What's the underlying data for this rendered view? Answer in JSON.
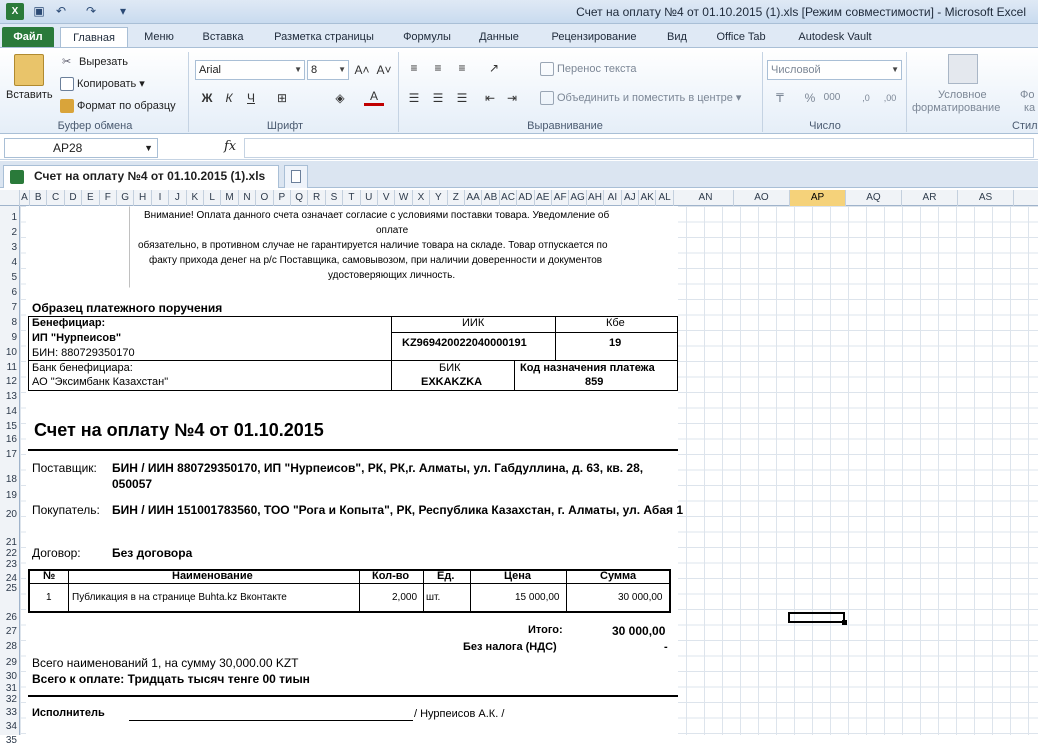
{
  "window": {
    "title": "Счет на оплату №4 от 01.10.2015 (1).xls  [Режим совместимости]  -  Microsoft Excel"
  },
  "tabs": [
    "Файл",
    "Главная",
    "Меню",
    "Вставка",
    "Разметка страницы",
    "Формулы",
    "Данные",
    "Рецензирование",
    "Вид",
    "Office Tab",
    "Autodesk Vault"
  ],
  "ribbon": {
    "paste": "Вставить",
    "cut": "Вырезать",
    "copy": "Копировать",
    "format_painter": "Формат по образцу",
    "clipboard_group": "Буфер обмена",
    "font_name": "Arial",
    "font_size": "8",
    "font_group": "Шрифт",
    "wrap_text": "Перенос текста",
    "merge_center": "Объединить и поместить в центре",
    "alignment_group": "Выравнивание",
    "number_format": "Числовой",
    "number_group": "Число",
    "conditional_1": "Условное",
    "conditional_2": "форматирование",
    "format_as_1": "Фо",
    "format_as_2": "ка",
    "styles_group": "Стил"
  },
  "formula_bar": {
    "name_box": "AP28",
    "fx": "fx",
    "value": ""
  },
  "doc_tab": "Счет на оплату №4 от 01.10.2015 (1).xls",
  "columns_narrow": [
    "A",
    "B",
    "C",
    "D",
    "E",
    "F",
    "G",
    "H",
    "I",
    "J",
    "K",
    "L",
    "M",
    "N",
    "O",
    "P",
    "Q",
    "R",
    "S",
    "T",
    "U",
    "V",
    "W",
    "X",
    "Y",
    "Z",
    "AA",
    "AB",
    "AC",
    "AD",
    "AE",
    "AF",
    "AG",
    "AH",
    "AI",
    "AJ",
    "AK",
    "AL"
  ],
  "columns_wide": [
    "AN",
    "AO",
    "AP",
    "AQ",
    "AR",
    "AS"
  ],
  "selected_column": "AP",
  "rows": [
    "1",
    "2",
    "3",
    "4",
    "5",
    "6",
    "7",
    "8",
    "9",
    "10",
    "11",
    "12",
    "13",
    "14",
    "15",
    "16",
    "17",
    "18",
    "19",
    "20",
    "21",
    "22",
    "23",
    "24",
    "25",
    "26",
    "27",
    "28",
    "29",
    "30",
    "31",
    "32",
    "33",
    "34",
    "35"
  ],
  "notice": {
    "l1": "Внимание! Оплата данного счета означает согласие с условиями поставки товара. Уведомление об",
    "l2": "оплате",
    "l3": "обязательно, в противном случае не гарантируется наличие товара на складе. Товар отпускается по",
    "l4": "факту  прихода денег на р/с Поставщика, самовывозом, при наличии доверенности и документов",
    "l5": "удостоверяющих личность."
  },
  "payment": {
    "heading": "Образец платежного поручения",
    "beneficiary_label": "Бенефициар:",
    "beneficiary_name": "ИП \"Нурпеисов\"",
    "beneficiary_bin": "БИН: 880729350170",
    "iik_label": "ИИК",
    "iik_value": "KZ969420022040000191",
    "kbe_label": "Кбе",
    "kbe_value": "19",
    "bank_label": "Банк бенефициара:",
    "bank_name": "АО \"Эксимбанк Казахстан\"",
    "bik_label": "БИК",
    "bik_value": "EXKAKZKA",
    "purpose_label": "Код назначения платежа",
    "purpose_value": "859"
  },
  "invoice": {
    "title": "Счет на оплату №4 от 01.10.2015",
    "supplier_label": "Поставщик:",
    "supplier_l1": "БИН / ИИН 880729350170, ИП \"Нурпеисов\", РК, РК,г. Алматы, ул. Габдуллина, д. 63, кв. 28,",
    "supplier_l2": "050057",
    "buyer_label": "Покупатель:",
    "buyer": "БИН / ИИН 151001783560, ТОО \"Рога и Копыта\", РК, Республика Казахстан, г. Алматы, ул. Абая 1",
    "contract_label": "Договор:",
    "contract": "Без договора"
  },
  "table": {
    "headers": [
      "№",
      "Наименование",
      "Кол-во",
      "Ед.",
      "Цена",
      "Сумма"
    ],
    "rows": [
      [
        "1",
        "Публикация в на странице Buhta.kz Вконтакте",
        "2,000",
        "шт.",
        "15 000,00",
        "30 000,00"
      ]
    ]
  },
  "totals": {
    "total_label": "Итого:",
    "total_value": "30 000,00",
    "vat_label": "Без налога (НДС)",
    "vat_value": "-",
    "count_line": "Всего наименований 1, на сумму 30,000.00 KZT",
    "words_line": "Всего к оплате: Тридцать тысяч тенге 00 тиын"
  },
  "signature": {
    "label": "Исполнитель",
    "name": "/ Нурпеисов А.К. /"
  }
}
